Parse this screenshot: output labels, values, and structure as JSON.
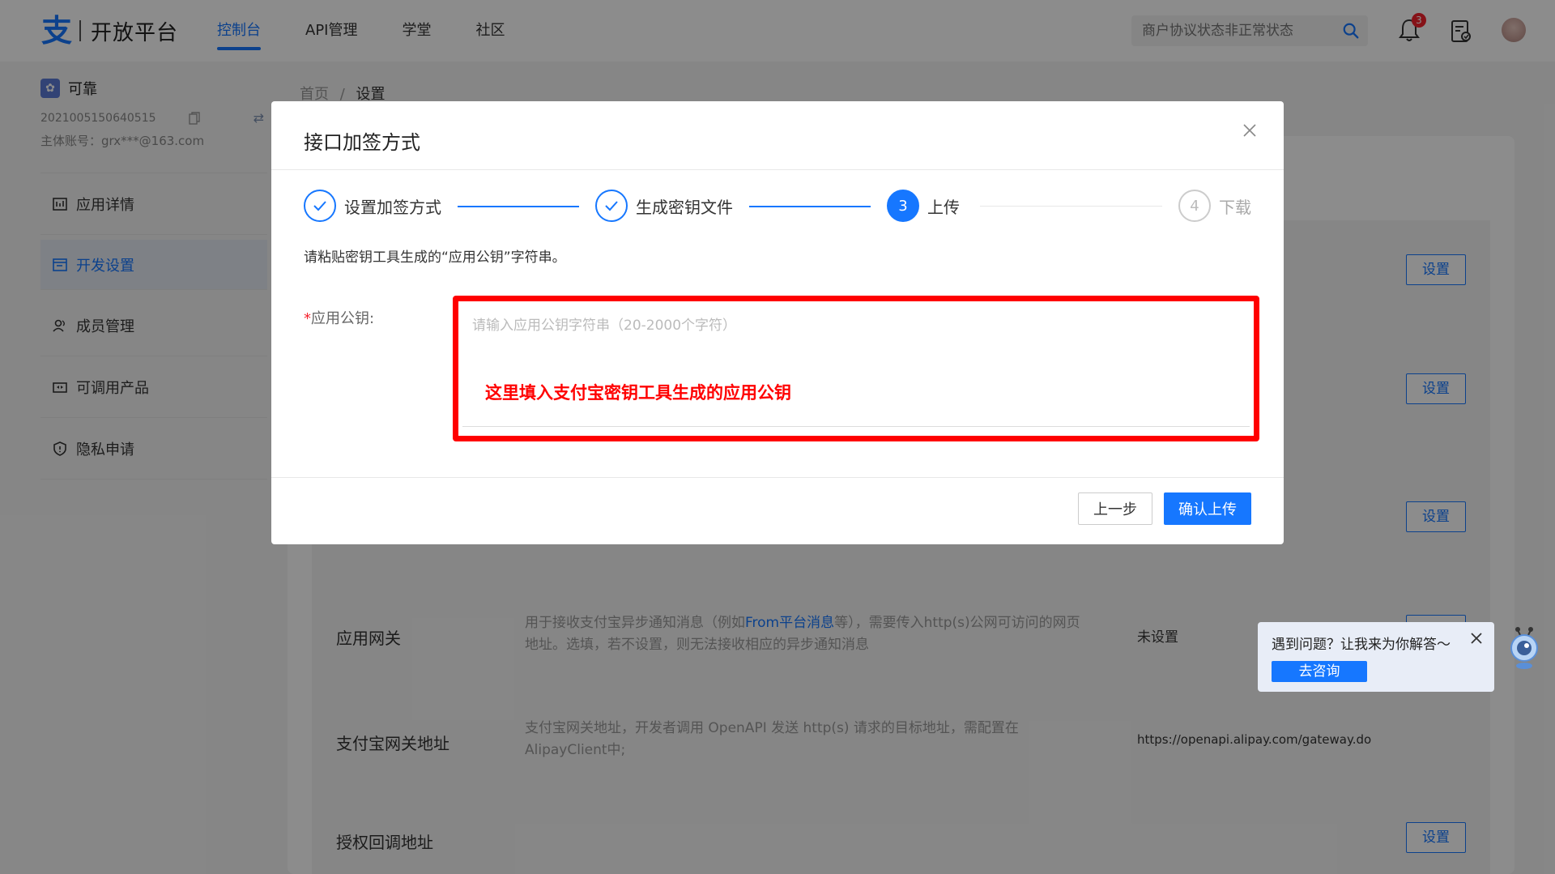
{
  "header": {
    "logo_text": "开放平台",
    "nav": [
      {
        "label": "控制台",
        "active": true
      },
      {
        "label": "API管理",
        "active": false
      },
      {
        "label": "学堂",
        "active": false
      },
      {
        "label": "社区",
        "active": false
      }
    ],
    "search_placeholder": "商户协议状态非正常状态",
    "notification_count": "3"
  },
  "sidebar": {
    "app_name": "可靠",
    "app_id": "2021005150640515",
    "account": "主体账号：grx***@163.com",
    "items": [
      {
        "label": "应用详情",
        "icon": "app-detail-icon",
        "active": false
      },
      {
        "label": "开发设置",
        "icon": "dev-settings-icon",
        "active": true
      },
      {
        "label": "成员管理",
        "icon": "members-icon",
        "active": false
      },
      {
        "label": "可调用产品",
        "icon": "products-icon",
        "active": false
      },
      {
        "label": "隐私申请",
        "icon": "privacy-icon",
        "active": false
      }
    ]
  },
  "breadcrumb": {
    "home": "首页",
    "sep": "/",
    "current": "设置"
  },
  "settings": {
    "set_label": "设置",
    "gateway": {
      "label": "应用网关",
      "desc_before": "用于接收支付宝异步通知消息（例如",
      "desc_link": "From平台消息",
      "desc_after": "等），需要传入http(s)公网可访问的网页地址。选填，若不设置，则无法接收相应的异步通知消息",
      "value": "未设置"
    },
    "alipay_gateway": {
      "label": "支付宝网关地址",
      "desc": "支付宝网关地址，开发者调用 OpenAPI 发送 http(s) 请求的目标地址，需配置在AlipayClient中;",
      "value": "https://openapi.alipay.com/gateway.do"
    },
    "auth_callback": {
      "label": "授权回调地址"
    }
  },
  "modal": {
    "title": "接口加签方式",
    "steps": [
      {
        "label": "设置加签方式",
        "status": "finish"
      },
      {
        "label": "生成密钥文件",
        "status": "finish"
      },
      {
        "label": "上传",
        "status": "process",
        "number": "3"
      },
      {
        "label": "下载",
        "status": "wait",
        "number": "4"
      }
    ],
    "hint": "请粘贴密钥工具生成的“应用公钥”字符串。",
    "field_required_mark": "*",
    "field_label": "应用公钥:",
    "field_placeholder": "请输入应用公钥字符串（20-2000个字符）",
    "annotation": "这里填入支付宝密钥工具生成的应用公钥",
    "prev_label": "上一步",
    "confirm_label": "确认上传"
  },
  "help": {
    "text": "遇到问题？让我来为你解答～",
    "button": "去咨询"
  },
  "colors": {
    "primary": "#1677ff",
    "annotation": "#ff0000",
    "badge": "#f5222d"
  }
}
